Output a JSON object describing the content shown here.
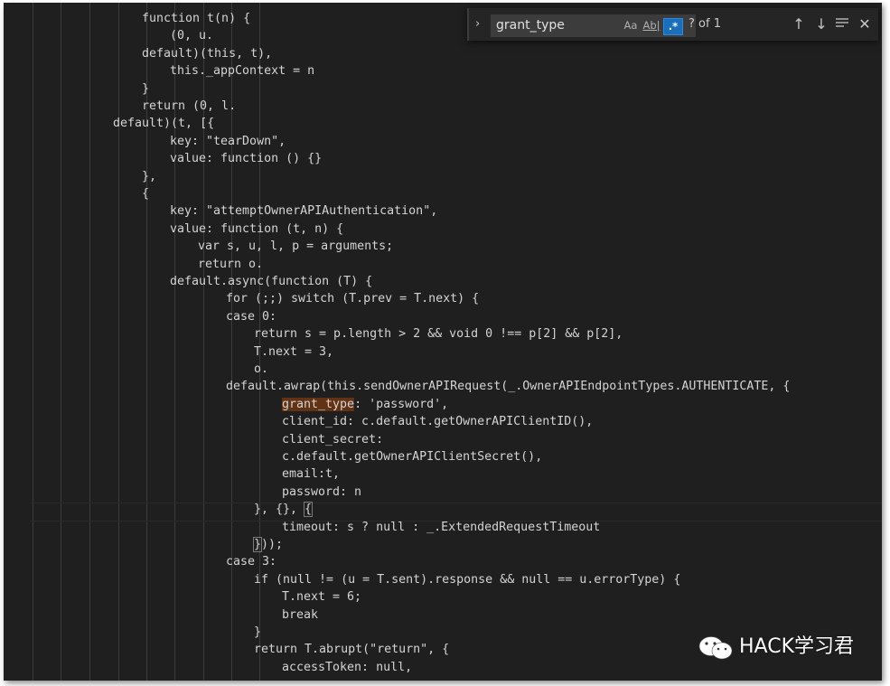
{
  "find_widget": {
    "query": "grant_type",
    "match_case_label": "Aa",
    "whole_word_label": "Ab|",
    "regex_label": ".*",
    "result_count": "? of 1",
    "expand_icon": "chevron-right-icon",
    "prev_icon": "arrow-up-icon",
    "next_icon": "arrow-down-icon",
    "selection_icon": "find-in-selection-icon",
    "close_icon": "close-icon"
  },
  "code_lines": [
    {
      "indent": 157,
      "parts": [
        {
          "t": "function t(n) {"
        }
      ]
    },
    {
      "indent": 188,
      "parts": [
        {
          "t": "(0, u."
        }
      ]
    },
    {
      "indent": 157,
      "parts": [
        {
          "t": "default)(this, t),"
        }
      ]
    },
    {
      "indent": 188,
      "parts": [
        {
          "t": "this._appContext = n"
        }
      ]
    },
    {
      "indent": 157,
      "parts": [
        {
          "t": "}"
        }
      ]
    },
    {
      "indent": 157,
      "parts": [
        {
          "t": "return (0, l."
        }
      ]
    },
    {
      "indent": 125,
      "parts": [
        {
          "t": "default)(t, [{"
        }
      ]
    },
    {
      "indent": 188,
      "parts": [
        {
          "t": "key: \"tearDown\","
        }
      ]
    },
    {
      "indent": 188,
      "parts": [
        {
          "t": "value: function () {}"
        }
      ]
    },
    {
      "indent": 157,
      "parts": [
        {
          "t": "},"
        }
      ]
    },
    {
      "indent": 157,
      "parts": [
        {
          "t": "{"
        }
      ]
    },
    {
      "indent": 188,
      "parts": [
        {
          "t": "key: \"attemptOwnerAPIAuthentication\","
        }
      ]
    },
    {
      "indent": 188,
      "parts": [
        {
          "t": "value: function (t, n) {"
        }
      ]
    },
    {
      "indent": 219,
      "parts": [
        {
          "t": "var s, u, l, p = arguments;"
        }
      ]
    },
    {
      "indent": 219,
      "parts": [
        {
          "t": "return o."
        }
      ]
    },
    {
      "indent": 188,
      "parts": [
        {
          "t": "default.async(function (T) {"
        }
      ]
    },
    {
      "indent": 250,
      "parts": [
        {
          "t": "for (;;) switch (T.prev = T.next) {"
        }
      ]
    },
    {
      "indent": 250,
      "parts": [
        {
          "t": "case 0:"
        }
      ]
    },
    {
      "indent": 281,
      "parts": [
        {
          "t": "return s = p.length > 2 && void 0 !== p[2] && p[2],"
        }
      ]
    },
    {
      "indent": 281,
      "parts": [
        {
          "t": "T.next = 3,"
        }
      ]
    },
    {
      "indent": 281,
      "parts": [
        {
          "t": "o."
        }
      ]
    },
    {
      "indent": 250,
      "parts": [
        {
          "t": "default.awrap(this.sendOwnerAPIRequest(_.OwnerAPIEndpointTypes.AUTHENTICATE, {"
        }
      ]
    },
    {
      "indent": 312,
      "parts": [
        {
          "t": "grant_type",
          "s": "match"
        },
        {
          "t": ": 'password',"
        }
      ]
    },
    {
      "indent": 312,
      "parts": [
        {
          "t": "client_id: c.default.getOwnerAPIClientID(),"
        }
      ]
    },
    {
      "indent": 312,
      "parts": [
        {
          "t": "client_secret:"
        }
      ]
    },
    {
      "indent": 312,
      "parts": [
        {
          "t": "c.default.getOwnerAPIClientSecret(),"
        }
      ]
    },
    {
      "indent": 312,
      "parts": [
        {
          "t": "email:t,"
        }
      ]
    },
    {
      "indent": 312,
      "parts": [
        {
          "t": "password: n"
        }
      ]
    },
    {
      "indent": 281,
      "parts": [
        {
          "t": "}, {}, "
        },
        {
          "t": "{",
          "s": "bracket"
        }
      ]
    },
    {
      "indent": 312,
      "parts": [
        {
          "t": "timeout: s ? null : _.ExtendedRequestTimeout"
        }
      ]
    },
    {
      "indent": 281,
      "parts": [
        {
          "t": "}",
          "s": "bracket"
        },
        {
          "t": "));"
        }
      ]
    },
    {
      "indent": 250,
      "parts": [
        {
          "t": "case 3:"
        }
      ]
    },
    {
      "indent": 281,
      "parts": [
        {
          "t": "if (null != (u = T.sent).response && null == u.errorType) {"
        }
      ]
    },
    {
      "indent": 312,
      "parts": [
        {
          "t": "T.next = 6;"
        }
      ]
    },
    {
      "indent": 312,
      "parts": [
        {
          "t": "break"
        }
      ]
    },
    {
      "indent": 281,
      "parts": [
        {
          "t": "}"
        }
      ]
    },
    {
      "indent": 281,
      "parts": [
        {
          "t": "return T.abrupt(\"return\", {"
        }
      ]
    },
    {
      "indent": 312,
      "parts": [
        {
          "t": "accessToken: null,"
        }
      ]
    }
  ],
  "watermark": {
    "text": "HACK学习君",
    "icon": "wechat-icon"
  },
  "colors": {
    "background": "#1f1f1f",
    "text": "#d4d4d4",
    "match_highlight": "#613214",
    "regex_active": "#1b6fba"
  }
}
